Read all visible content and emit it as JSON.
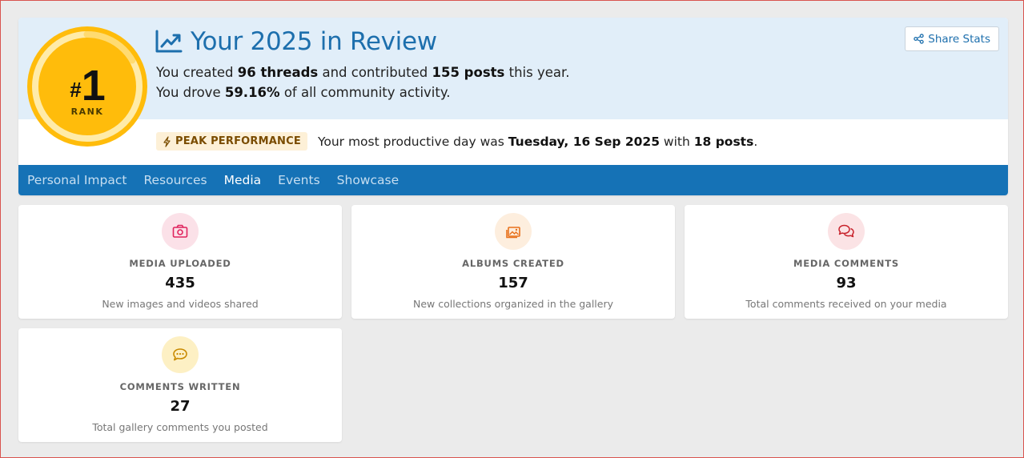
{
  "hero": {
    "title": "Your 2025 in Review",
    "rank": {
      "hash": "#",
      "number": "1",
      "label": "RANK"
    },
    "summary": {
      "line1_prefix": "You created ",
      "threads": "96 threads",
      "line1_mid": " and contributed ",
      "posts": "155 posts",
      "line1_suffix": " this year.",
      "line2_prefix": "You drove ",
      "activity": "59.16%",
      "line2_suffix": " of all community activity."
    },
    "share_label": "Share Stats",
    "peak": {
      "badge": "PEAK PERFORMANCE",
      "text_prefix": "Your most productive day was ",
      "day": "Tuesday, 16 Sep 2025",
      "text_mid": " with ",
      "count": "18 posts",
      "text_suffix": "."
    }
  },
  "tabs": [
    {
      "label": "Personal Impact",
      "active": false
    },
    {
      "label": "Resources",
      "active": false
    },
    {
      "label": "Media",
      "active": true
    },
    {
      "label": "Events",
      "active": false
    },
    {
      "label": "Showcase",
      "active": false
    }
  ],
  "cards": [
    {
      "icon": "camera-icon",
      "label": "MEDIA UPLOADED",
      "value": "435",
      "desc": "New images and videos shared",
      "icon_bg": "#fbe1e8",
      "icon_color": "#e0245e"
    },
    {
      "icon": "albums-icon",
      "label": "ALBUMS CREATED",
      "value": "157",
      "desc": "New collections organized in the gallery",
      "icon_bg": "#fdeede",
      "icon_color": "#e8711c"
    },
    {
      "icon": "comments-icon",
      "label": "MEDIA COMMENTS",
      "value": "93",
      "desc": "Total comments received on your media",
      "icon_bg": "#fbe3e5",
      "icon_color": "#c8232c"
    },
    {
      "icon": "comment-dots-icon",
      "label": "COMMENTS WRITTEN",
      "value": "27",
      "desc": "Total gallery comments you posted",
      "icon_bg": "#fdf0c4",
      "icon_color": "#c98a00"
    }
  ],
  "colors": {
    "accent": "#1572b6",
    "title": "#1d6fad",
    "rank_gold": "#ffbc0b",
    "hero_bg": "#e1eef9"
  }
}
